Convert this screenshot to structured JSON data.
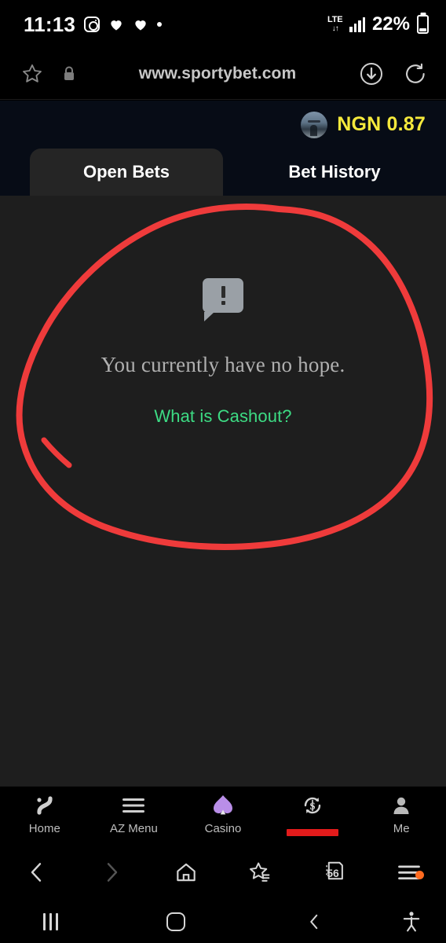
{
  "status_bar": {
    "time": "11:13",
    "icons": [
      "instagram-icon",
      "heart-icon",
      "heart-icon",
      "dot-icon"
    ],
    "network_type": "LTE",
    "signal_bars": 4,
    "battery_percent": "22%"
  },
  "browser": {
    "url": "www.sportybet.com",
    "left_icons": [
      "bookmark-star-icon",
      "lock-icon"
    ],
    "right_icons": [
      "download-icon",
      "reload-icon"
    ],
    "toolbar": {
      "back": "back-icon",
      "forward": "forward-icon",
      "home": "home-icon",
      "bookmarks": "bookmarks-icon",
      "tabs_count": "56",
      "menu": "menu-icon",
      "menu_has_notification": true
    }
  },
  "site_header": {
    "avatar": "user-avatar",
    "balance": "NGN 0.87",
    "balance_color": "#f5e93c"
  },
  "tabs": [
    {
      "label": "Open Bets",
      "active": true
    },
    {
      "label": "Bet History",
      "active": false
    }
  ],
  "empty_state": {
    "icon": "alert-speech-bubble-icon",
    "message": "You currently have no hope.",
    "link": "What is Cashout?",
    "link_color": "#3ddc84"
  },
  "annotation": {
    "type": "hand-drawn-circle",
    "color": "#ef3b3b",
    "secondary": "hand-drawn-underline"
  },
  "app_nav": [
    {
      "label": "Home",
      "icon": "sportybet-s-icon",
      "active": false
    },
    {
      "label": "AZ Menu",
      "icon": "hamburger-icon",
      "active": false
    },
    {
      "label": "Casino",
      "icon": "spade-icon",
      "active": false
    },
    {
      "label": "",
      "icon": "cashout-refresh-icon",
      "active": false,
      "annotated": true
    },
    {
      "label": "Me",
      "icon": "person-icon",
      "active": false
    }
  ],
  "system_nav": {
    "recents": "recents-icon",
    "home": "home-square-icon",
    "back": "back-chevron-icon",
    "accessibility": "accessibility-icon"
  }
}
